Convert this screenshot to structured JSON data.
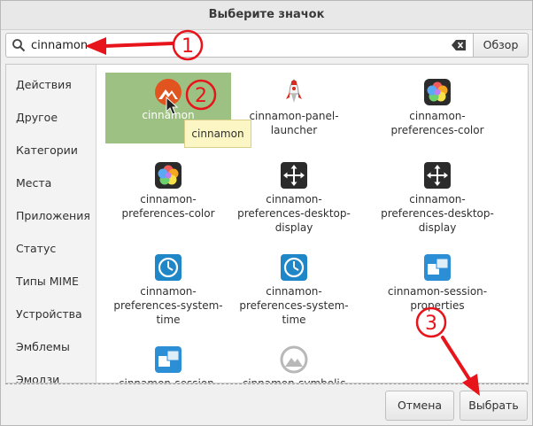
{
  "window": {
    "title": "Выберите значок"
  },
  "search": {
    "value": "cinnamon",
    "browse_label": "Обзор"
  },
  "sidebar": {
    "items": [
      {
        "label": "Действия"
      },
      {
        "label": "Другое"
      },
      {
        "label": "Категории"
      },
      {
        "label": "Места"
      },
      {
        "label": "Приложения"
      },
      {
        "label": "Статус"
      },
      {
        "label": "Типы MIME"
      },
      {
        "label": "Устройства"
      },
      {
        "label": "Эмблемы"
      },
      {
        "label": "Эмодзи"
      }
    ]
  },
  "icons": [
    {
      "label": "cinnamon",
      "icon": "cinnamon-logo-icon",
      "selected": true
    },
    {
      "label": "cinnamon-panel-\nlauncher",
      "icon": "rocket-icon"
    },
    {
      "label": "cinnamon-\npreferences-color",
      "icon": "color-flower-icon"
    },
    {
      "label": "cinnamon-\npreferences-color",
      "icon": "color-flower-icon"
    },
    {
      "label": "cinnamon-\npreferences-desktop-\ndisplay",
      "icon": "display-arrows-icon"
    },
    {
      "label": "cinnamon-\npreferences-desktop-\ndisplay",
      "icon": "display-arrows-icon"
    },
    {
      "label": "cinnamon-\npreferences-system-\ntime",
      "icon": "clock-icon"
    },
    {
      "label": "cinnamon-\npreferences-system-\ntime",
      "icon": "clock-icon"
    },
    {
      "label": "cinnamon-session-\nproperties",
      "icon": "session-windows-icon"
    },
    {
      "label": "cinnamon-session-",
      "icon": "session-windows-icon"
    },
    {
      "label": "cinnamon-symbolic",
      "icon": "cinnamon-symbolic-icon"
    }
  ],
  "tooltip": {
    "text": "cinnamon"
  },
  "buttons": {
    "cancel": "Отмена",
    "select": "Выбрать"
  },
  "annotations": {
    "step1": "1",
    "step2": "2",
    "step3": "3",
    "color": "#e8141b"
  },
  "colors": {
    "selection": "#9dc182",
    "tooltip_bg": "#fbf6c3",
    "cinnamon_orange": "#e2541f"
  }
}
